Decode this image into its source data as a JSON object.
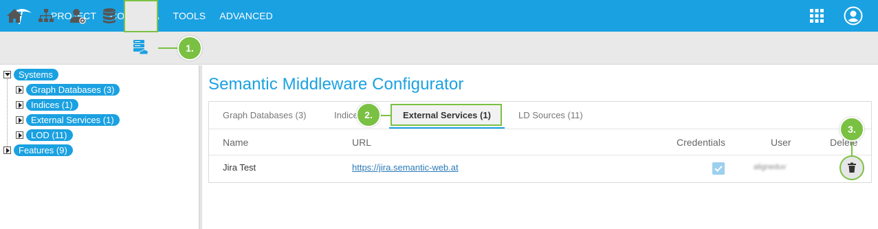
{
  "topbar": {
    "menu": [
      "PROJECT",
      "CORPORA",
      "TOOLS",
      "ADVANCED"
    ],
    "icons": [
      "app-logo-icon",
      "apps-grid-icon",
      "user-account-icon"
    ],
    "color": "#1aa1e1"
  },
  "toolbar": {
    "icons": [
      "home-icon",
      "hierarchy-icon",
      "user-settings-icon",
      "database-icon",
      "database-cloud-icon"
    ],
    "active": "database-cloud-icon"
  },
  "tree": {
    "root": "Systems",
    "children": [
      "Graph Databases (3)",
      "Indices (1)",
      "External Services (1)",
      "LOD (11)"
    ],
    "features": "Features (9)"
  },
  "main": {
    "title": "Semantic Middleware Configurator",
    "tabs": [
      "Graph Databases (3)",
      "Indices (1)",
      "External Services (1)",
      "LD Sources (11)"
    ],
    "active_tab": "External Services (1)",
    "columns": [
      "Name",
      "URL",
      "Credentials",
      "User",
      "Delete"
    ],
    "rows": [
      {
        "name": "Jira Test",
        "url": "https://jira.semantic-web.at",
        "credentials": true,
        "user": "aligneduv"
      }
    ]
  },
  "callouts": [
    "1.",
    "2.",
    "3."
  ],
  "colors": {
    "accent": "#1aa1e1",
    "callout": "#7ac143"
  }
}
